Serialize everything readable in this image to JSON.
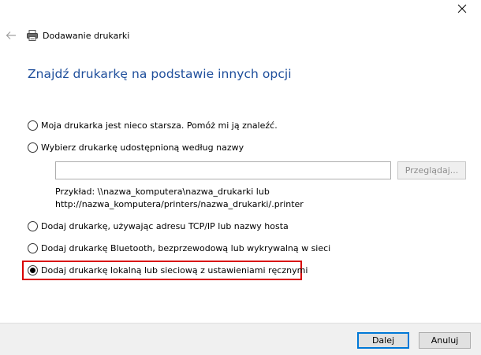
{
  "window": {
    "title": "Dodawanie drukarki",
    "icons": {
      "close": "close-icon",
      "back": "back-arrow-icon",
      "app": "printer-icon"
    }
  },
  "heading": "Znajdź drukarkę na podstawie innych opcji",
  "options": [
    {
      "label": "Moja drukarka jest nieco starsza. Pomóż mi ją znaleźć.",
      "checked": false
    },
    {
      "label": "Wybierz drukarkę udostępnioną według nazwy",
      "checked": false
    },
    {
      "label": "Dodaj drukarkę, używając adresu TCP/IP lub nazwy hosta",
      "checked": false
    },
    {
      "label": "Dodaj drukarkę Bluetooth, bezprzewodową lub wykrywalną w sieci",
      "checked": false
    },
    {
      "label": "Dodaj drukarkę lokalną lub sieciową z ustawieniami ręcznymi",
      "checked": true
    }
  ],
  "shared_printer": {
    "input_value": "",
    "browse_label": "Przeglądaj...",
    "example_line1": "Przykład: \\\\nazwa_komputera\\nazwa_drukarki lub",
    "example_line2": "http://nazwa_komputera/printers/nazwa_drukarki/.printer"
  },
  "footer": {
    "next_label": "Dalej",
    "cancel_label": "Anuluj"
  },
  "colors": {
    "heading": "#1e4e9b",
    "highlight": "#d90000",
    "primary_border": "#0078d7"
  }
}
